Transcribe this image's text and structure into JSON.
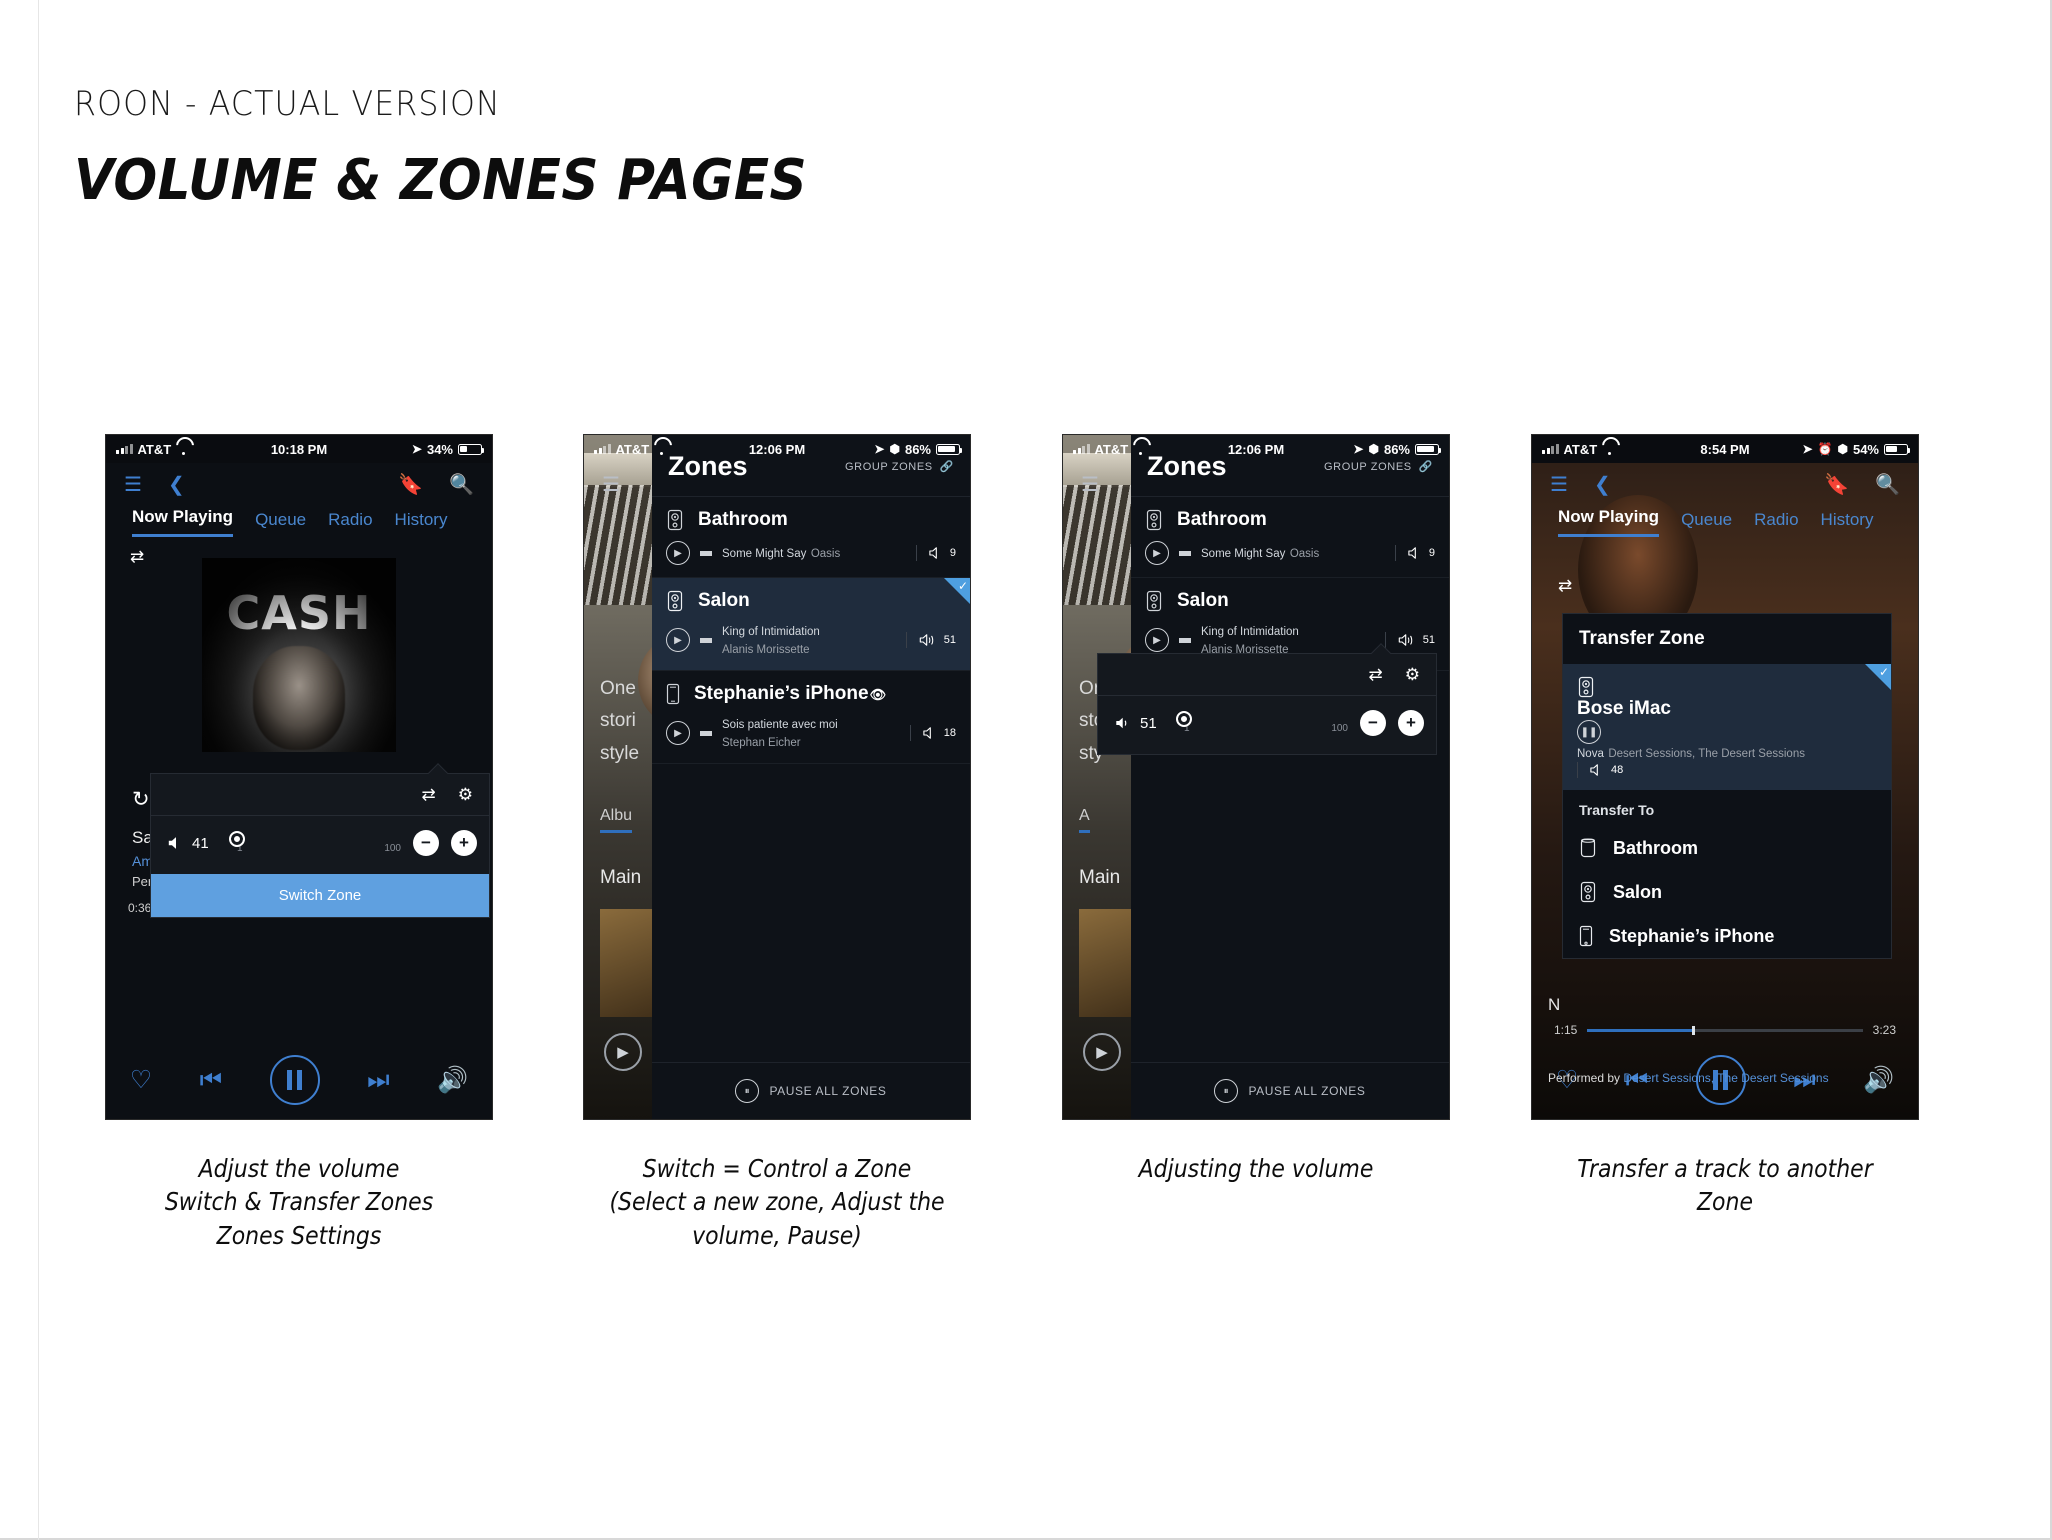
{
  "header": {
    "kicker": "ROON - ACTUAL VERSION",
    "title": "VOLUME & ZONES PAGES"
  },
  "captions": {
    "c1": "Adjust the volume\nSwitch & Transfer Zones\nZones Settings",
    "c2": "Switch = Control a Zone\n(Select a new zone, Adjust the\nvolume, Pause)",
    "c3": "Adjusting the volume",
    "c4": "Transfer a track to another\nZone"
  },
  "phone1": {
    "status": {
      "carrier": "AT&T",
      "time": "10:18 PM",
      "battery": "34%"
    },
    "nav": {
      "menu": "menu-icon",
      "back": "back-icon",
      "bookmark": "bookmark-icon",
      "search": "search-icon"
    },
    "tabs": [
      {
        "label": "Now Playing",
        "active": true
      },
      {
        "label": "Queue",
        "active": false
      },
      {
        "label": "Radio",
        "active": false
      },
      {
        "label": "History",
        "active": false
      }
    ],
    "artwork_word": "CASH",
    "meta": {
      "title": "Sa",
      "artist": "Am",
      "performed": "Per"
    },
    "progress": {
      "elapsed": "0:36"
    },
    "volume_popup": {
      "value": "41",
      "min": "1",
      "max": "100",
      "minus": "−",
      "plus": "+",
      "switch_zone_label": "Switch Zone"
    }
  },
  "phone2": {
    "status": {
      "carrier": "AT&T",
      "time": "12:06 PM",
      "battery": "86%"
    },
    "zones": {
      "title": "Zones",
      "group_label": "GROUP ZONES",
      "pause_all_label": "PAUSE ALL ZONES",
      "items": [
        {
          "name": "Bathroom",
          "device": "speaker-icon",
          "track": "Some Might Say",
          "artist": "Oasis",
          "volume": "9",
          "selected": false,
          "playing": false,
          "eye": false
        },
        {
          "name": "Salon",
          "device": "speaker-icon",
          "track": "King of Intimidation",
          "artist": "Alanis Morissette",
          "volume": "51",
          "selected": true,
          "playing": false,
          "eye": false
        },
        {
          "name": "Stephanie’s iPhone",
          "device": "phone-icon",
          "track": "Sois patiente avec moi",
          "artist": "Stephan Eicher",
          "volume": "18",
          "selected": false,
          "playing": false,
          "eye": true
        }
      ]
    },
    "background": {
      "text": "One\nstori\nstyle",
      "tab": "Albu",
      "main": "Main"
    }
  },
  "phone3": {
    "status": {
      "carrier": "AT&T",
      "time": "12:06 PM",
      "battery": "86%"
    },
    "zones": {
      "title": "Zones",
      "group_label": "GROUP ZONES",
      "pause_all_label": "PAUSE ALL ZONES",
      "items": [
        {
          "name": "Bathroom",
          "device": "speaker-icon",
          "track": "Some Might Say",
          "artist": "Oasis",
          "volume": "9",
          "selected": false,
          "eye": false
        },
        {
          "name": "Salon",
          "device": "speaker-icon",
          "track": "King of Intimidation",
          "artist": "Alanis Morissette",
          "volume": "51",
          "selected": false,
          "eye": false
        }
      ]
    },
    "volume_popup": {
      "value": "51",
      "min": "1",
      "max": "100",
      "minus": "−",
      "plus": "+"
    },
    "background": {
      "text": "One\nsto\nsty",
      "tab": "A",
      "main": "Main"
    }
  },
  "phone4": {
    "status": {
      "carrier": "AT&T",
      "time": "8:54 PM",
      "battery": "54%"
    },
    "tabs": [
      {
        "label": "Now Playing",
        "active": true
      },
      {
        "label": "Queue",
        "active": false
      },
      {
        "label": "Radio",
        "active": false
      },
      {
        "label": "History",
        "active": false
      }
    ],
    "transfer_dialog": {
      "title": "Transfer Zone",
      "current": {
        "name": "Bose iMac",
        "device": "speaker-icon",
        "track": "Nova",
        "artist": "Desert Sessions, The Desert Sessions",
        "volume": "48"
      },
      "transfer_to_label": "Transfer To",
      "targets": [
        {
          "name": "Bathroom",
          "device": "speaker-plain-icon"
        },
        {
          "name": "Salon",
          "device": "speaker-icon"
        },
        {
          "name": "Stephanie’s iPhone",
          "device": "phone-icon"
        }
      ]
    },
    "meta": {
      "bg_title": "N",
      "performed_prefix": "Performed by ",
      "performed_link": "Desert Sessions, The Desert Sessions"
    },
    "progress": {
      "elapsed": "1:15",
      "total": "3:23"
    }
  },
  "colors": {
    "accent_blue": "#3f7fd0",
    "selected_row": "#1f2c3d",
    "check_corner": "#4e9fe0",
    "panel_bg": "#0e1218",
    "switch_zone_bg": "#5fa0e0"
  }
}
